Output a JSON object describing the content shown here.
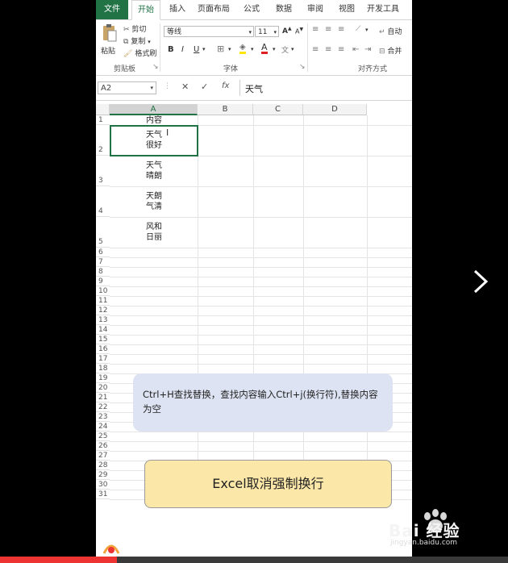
{
  "ribbon_tabs": [
    "文件",
    "开始",
    "插入",
    "页面布局",
    "公式",
    "数据",
    "审阅",
    "视图",
    "开发工具"
  ],
  "clipboard": {
    "paste": "粘贴",
    "cut": "剪切",
    "copy": "复制",
    "format_painter": "格式刷",
    "group": "剪贴板"
  },
  "font": {
    "name": "等线",
    "size": "11",
    "bold": "B",
    "italic": "I",
    "underline": "U",
    "increase": "A",
    "decrease": "A",
    "color_letter": "A",
    "group": "字体"
  },
  "alignment": {
    "wrap": "自动",
    "merge": "合并",
    "group": "对齐方式"
  },
  "formula_bar": {
    "name_box": "A2",
    "content": "天气",
    "fx": "fx"
  },
  "columns": [
    "A",
    "B",
    "C",
    "D"
  ],
  "rows": {
    "tall": [
      {
        "num": "1",
        "lines": [
          "内容"
        ]
      },
      {
        "num": "2",
        "lines": [
          "天气",
          "很好"
        ]
      },
      {
        "num": "3",
        "lines": [
          "天气",
          "晴朗"
        ]
      },
      {
        "num": "4",
        "lines": [
          "天朗",
          "气清"
        ]
      },
      {
        "num": "5",
        "lines": [
          "风和",
          "日丽"
        ]
      }
    ],
    "short": [
      "6",
      "7",
      "8",
      "9",
      "10",
      "11",
      "12",
      "13",
      "14",
      "15",
      "16",
      "17",
      "18",
      "19",
      "20",
      "21",
      "22",
      "23",
      "24",
      "25",
      "26",
      "27",
      "28",
      "29",
      "30",
      "31"
    ]
  },
  "note": "Ctrl+H查找替换，查找内容输入Ctrl+j(换行符),替换内容为空",
  "banner": "Excel取消强制换行",
  "watermark": {
    "brand": "Bai 经验",
    "url": "jingyan.baidu.com"
  },
  "progress": 0.23,
  "colors": {
    "excel_green": "#217346",
    "note_bg": "#dde3f3",
    "banner_bg": "#fbe7a8"
  }
}
